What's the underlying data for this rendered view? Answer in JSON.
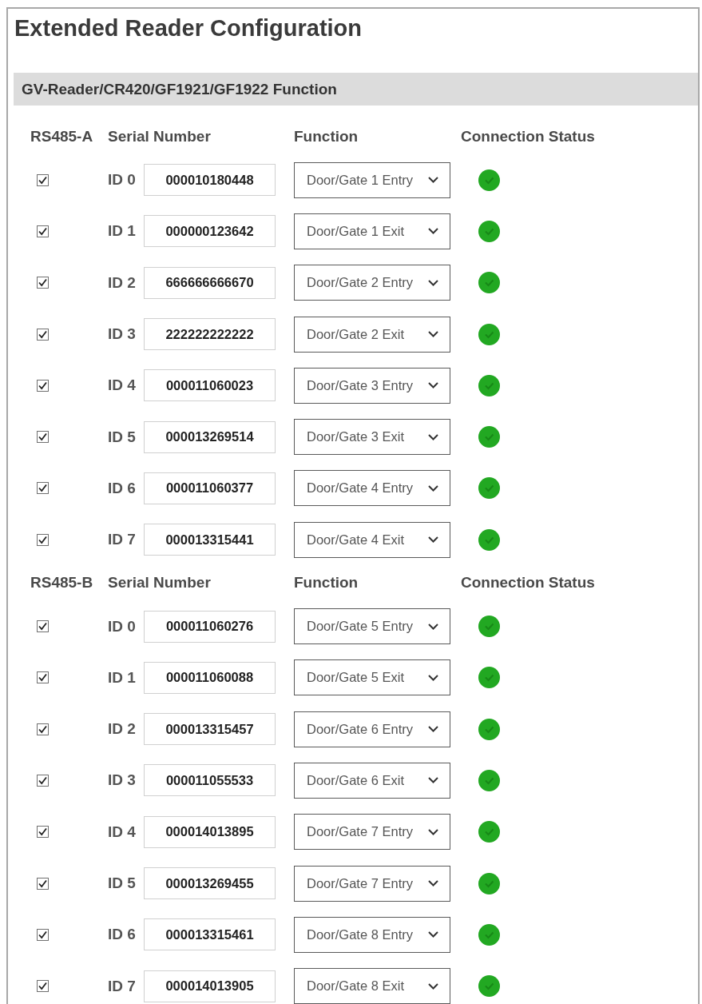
{
  "title": "Extended Reader Configuration",
  "section": {
    "title": "GV-Reader/CR420/GF1921/GF1922 Function",
    "buses": [
      {
        "label": "RS485-A",
        "columns": [
          "Serial Number",
          "Function",
          "Connection Status"
        ],
        "readers": [
          {
            "checked": true,
            "id": "ID 0",
            "serial": "000010180448",
            "function": "Door/Gate 1 Entry",
            "connected": true
          },
          {
            "checked": true,
            "id": "ID 1",
            "serial": "000000123642",
            "function": "Door/Gate 1 Exit",
            "connected": true
          },
          {
            "checked": true,
            "id": "ID 2",
            "serial": "666666666670",
            "function": "Door/Gate 2 Entry",
            "connected": true
          },
          {
            "checked": true,
            "id": "ID 3",
            "serial": "222222222222",
            "function": "Door/Gate 2 Exit",
            "connected": true
          },
          {
            "checked": true,
            "id": "ID 4",
            "serial": "000011060023",
            "function": "Door/Gate 3 Entry",
            "connected": true
          },
          {
            "checked": true,
            "id": "ID 5",
            "serial": "000013269514",
            "function": "Door/Gate 3 Exit",
            "connected": true
          },
          {
            "checked": true,
            "id": "ID 6",
            "serial": "000011060377",
            "function": "Door/Gate 4 Entry",
            "connected": true
          },
          {
            "checked": true,
            "id": "ID 7",
            "serial": "000013315441",
            "function": "Door/Gate 4 Exit",
            "connected": true
          }
        ]
      },
      {
        "label": "RS485-B",
        "columns": [
          "Serial Number",
          "Function",
          "Connection Status"
        ],
        "readers": [
          {
            "checked": true,
            "id": "ID 0",
            "serial": "000011060276",
            "function": "Door/Gate 5 Entry",
            "connected": true
          },
          {
            "checked": true,
            "id": "ID 1",
            "serial": "000011060088",
            "function": "Door/Gate 5 Exit",
            "connected": true
          },
          {
            "checked": true,
            "id": "ID 2",
            "serial": "000013315457",
            "function": "Door/Gate 6 Entry",
            "connected": true
          },
          {
            "checked": true,
            "id": "ID 3",
            "serial": "000011055533",
            "function": "Door/Gate 6 Exit",
            "connected": true
          },
          {
            "checked": true,
            "id": "ID 4",
            "serial": "000014013895",
            "function": "Door/Gate 7 Entry",
            "connected": true
          },
          {
            "checked": true,
            "id": "ID 5",
            "serial": "000013269455",
            "function": "Door/Gate 7 Entry",
            "connected": true
          },
          {
            "checked": true,
            "id": "ID 6",
            "serial": "000013315461",
            "function": "Door/Gate 8 Entry",
            "connected": true
          },
          {
            "checked": true,
            "id": "ID 7",
            "serial": "000014013905",
            "function": "Door/Gate 8 Exit",
            "connected": true
          }
        ]
      }
    ]
  }
}
